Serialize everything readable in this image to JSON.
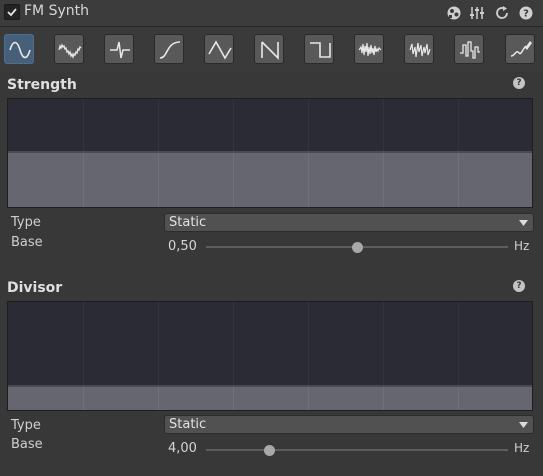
{
  "header": {
    "enabled": true,
    "title": "FM Synth",
    "icons": [
      "preset-icon",
      "settings-sliders-icon",
      "reset-icon",
      "help-icon"
    ]
  },
  "toolbar": {
    "waveforms": [
      {
        "name": "sine",
        "active": true
      },
      {
        "name": "noise-sine",
        "active": false
      },
      {
        "name": "pulse",
        "active": false
      },
      {
        "name": "smooth-step",
        "active": false
      },
      {
        "name": "triangle",
        "active": false
      },
      {
        "name": "sawtooth",
        "active": false
      },
      {
        "name": "square",
        "active": false
      },
      {
        "name": "noise",
        "active": false
      },
      {
        "name": "random-noise",
        "active": false
      },
      {
        "name": "step-noise",
        "active": false
      },
      {
        "name": "custom-curve",
        "active": false
      }
    ]
  },
  "strength": {
    "title": "Strength",
    "type_label": "Type",
    "type_value": "Static",
    "base_label": "Base",
    "base_value": "0,50",
    "unit": "Hz",
    "slider_fraction": 0.5,
    "graph_fill_fraction": 0.5
  },
  "divisor": {
    "title": "Divisor",
    "type_label": "Type",
    "type_value": "Static",
    "base_label": "Base",
    "base_value": "4,00",
    "unit": "Hz",
    "slider_fraction": 0.21,
    "graph_fill_fraction": 0.21
  },
  "colors": {
    "background": "#383838",
    "active_button": "#46607a",
    "graph_bg": "#2b2b35",
    "graph_fill": "#666670"
  }
}
